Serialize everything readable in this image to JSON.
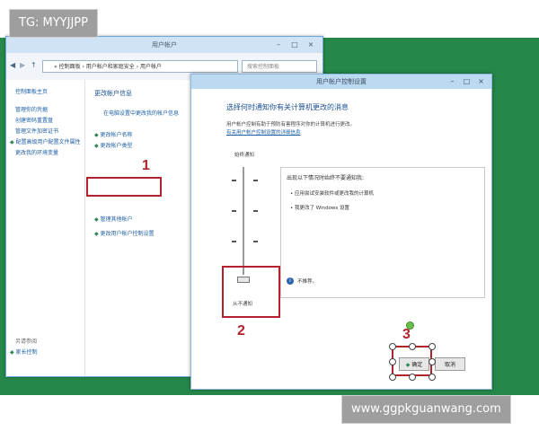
{
  "overlay": {
    "tag_top": "TG: MYYJJPP",
    "tag_bottom": "www.ggpkguanwang.com"
  },
  "main_window": {
    "title": "用户帐户",
    "controls": [
      "–",
      "□",
      "×"
    ],
    "nav": [
      "◀",
      "▶",
      "↑"
    ],
    "address": "« 控制面板 › 用户帐户和家庭安全 › 用户帐户",
    "search_placeholder": "搜索控制面板",
    "sidebar": {
      "items": [
        "控制面板主页",
        "管理你的凭据",
        "创建密码重置盘",
        "管理文件加密证书",
        "配置高级用户配置文件属性",
        "更改我的环境变量"
      ],
      "see_also_title": "另请参阅",
      "see_also_items": [
        "家长控制"
      ]
    },
    "content": {
      "heading": "更改帐户信息",
      "link_pc_settings": "在电脑设置中更改我的帐户信息",
      "links": [
        "更改帐户名称",
        "更改帐户类型",
        "管理其他帐户",
        "更改用户帐户控制设置"
      ]
    }
  },
  "dialog": {
    "title": "用户帐户控制设置",
    "controls": [
      "–",
      "□",
      "×"
    ],
    "heading": "选择何时通知你有关计算机更改的消息",
    "description": "用户帐户控制有助于预防有害程序对你的计算机进行更改。",
    "link": "有关用户帐户控制设置的详细信息",
    "slider": {
      "top_label": "始终通知",
      "bottom_label": "从不通知",
      "level_index": 0,
      "levels": 4
    },
    "info": {
      "heading": "出现以下情况时始终不要通知我:",
      "bullets": [
        "应用尝试安装软件或更改我的计算机",
        "我更改了 Windows 设置"
      ],
      "note": "不推荐。",
      "info_icon": "info-icon"
    },
    "ok_label": "确定",
    "cancel_label": "取消",
    "ok_icon": "shield-icon"
  },
  "annotations": {
    "step1": "1",
    "step2": "2",
    "step3": "3"
  },
  "colors": {
    "desktop": "#25884a",
    "annotation": "#b3232d",
    "link": "#1d5fa5"
  }
}
